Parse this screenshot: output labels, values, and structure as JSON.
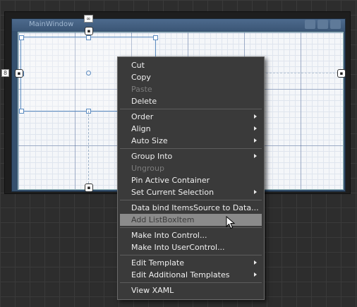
{
  "window": {
    "title": "MainWindow"
  },
  "designer": {
    "width_badge": "∞",
    "margin_badge": "8"
  },
  "context_menu": {
    "items": [
      {
        "label": "Cut",
        "enabled": true,
        "submenu": false
      },
      {
        "label": "Copy",
        "enabled": true,
        "submenu": false
      },
      {
        "label": "Paste",
        "enabled": false,
        "submenu": false
      },
      {
        "label": "Delete",
        "enabled": true,
        "submenu": false
      },
      {
        "label": "Order",
        "enabled": true,
        "submenu": true
      },
      {
        "label": "Align",
        "enabled": true,
        "submenu": true
      },
      {
        "label": "Auto Size",
        "enabled": true,
        "submenu": true
      },
      {
        "label": "Group Into",
        "enabled": true,
        "submenu": true
      },
      {
        "label": "Ungroup",
        "enabled": false,
        "submenu": false
      },
      {
        "label": "Pin Active Container",
        "enabled": true,
        "submenu": false
      },
      {
        "label": "Set Current Selection",
        "enabled": true,
        "submenu": true
      },
      {
        "label": "Data bind ItemsSource to Data...",
        "enabled": true,
        "submenu": false
      },
      {
        "label": "Add ListBoxItem",
        "enabled": true,
        "submenu": false,
        "highlighted": true
      },
      {
        "label": "Make Into Control...",
        "enabled": true,
        "submenu": false
      },
      {
        "label": "Make Into UserControl...",
        "enabled": true,
        "submenu": false
      },
      {
        "label": "Edit Template",
        "enabled": true,
        "submenu": true
      },
      {
        "label": "Edit Additional Templates",
        "enabled": true,
        "submenu": true
      },
      {
        "label": "View XAML",
        "enabled": true,
        "submenu": false
      }
    ]
  },
  "colors": {
    "menu_bg": "#3a3a3a",
    "highlight": "#8b8b8b",
    "disabled_text": "#7c7c7c",
    "selection_border": "#5b8bc0"
  }
}
